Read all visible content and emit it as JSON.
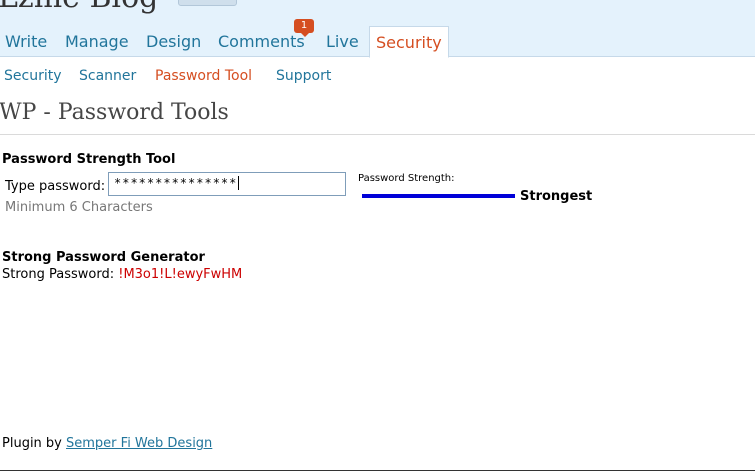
{
  "header": {
    "blog_title": "Lzme Blog"
  },
  "tabs": [
    {
      "label": "Write"
    },
    {
      "label": "Manage"
    },
    {
      "label": "Design"
    },
    {
      "label": "Comments",
      "badge": "1"
    },
    {
      "label": "Live"
    },
    {
      "label": "Security",
      "active": true
    }
  ],
  "subnav": [
    {
      "label": "Security"
    },
    {
      "label": "Scanner"
    },
    {
      "label": "Password Tool",
      "current": true
    },
    {
      "label": "Support"
    }
  ],
  "page_title": "WP - Password Tools",
  "strength_tool": {
    "title": "Password Strength Tool",
    "type_label": "Type password:",
    "password_value": "***************",
    "strength_label": "Password Strength:",
    "strength_value": "Strongest",
    "strength_fill_fraction": 1.0,
    "strength_color": "#0000d8",
    "hint": "Minimum 6 Characters"
  },
  "generator": {
    "title": "Strong Password Generator",
    "label": "Strong Password:",
    "password": "!M3o1!L!ewyFwHM"
  },
  "footer": {
    "prefix": "Plugin by",
    "link": "Semper Fi Web Design"
  },
  "colors": {
    "link": "#21759b",
    "active": "#d54e21",
    "header_bg": "#e4f2fc"
  }
}
